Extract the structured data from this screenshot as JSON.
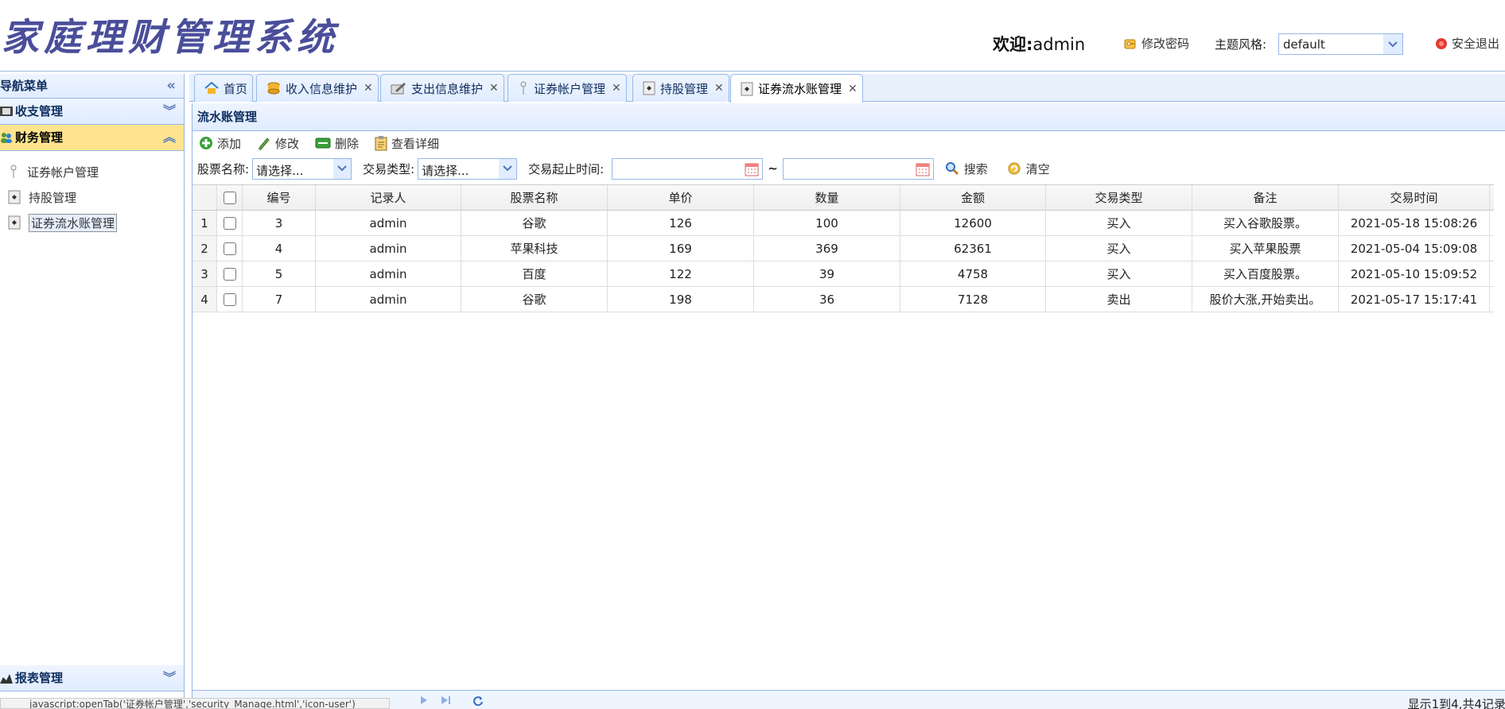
{
  "header": {
    "logo_text": "家庭理财管理系统",
    "welcome_label": "欢迎:",
    "username": "admin",
    "change_password": "修改密码",
    "theme_label": "主题风格:",
    "theme_value": "default",
    "logout": "安全退出"
  },
  "sidebar": {
    "title": "导航菜单",
    "groups": [
      {
        "label": "收支管理"
      },
      {
        "label": "财务管理"
      },
      {
        "label": "报表管理"
      }
    ],
    "items": [
      {
        "label": "证券帐户管理"
      },
      {
        "label": "持股管理"
      },
      {
        "label": "证券流水账管理"
      }
    ]
  },
  "tabs": [
    {
      "label": "首页"
    },
    {
      "label": "收入信息维护"
    },
    {
      "label": "支出信息维护"
    },
    {
      "label": "证券帐户管理"
    },
    {
      "label": "持股管理"
    },
    {
      "label": "证券流水账管理"
    }
  ],
  "panel": {
    "title": "流水账管理",
    "toolbar": {
      "add": "添加",
      "edit": "修改",
      "delete": "删除",
      "detail": "查看详细"
    },
    "search": {
      "stock_label": "股票名称:",
      "stock_value": "请选择...",
      "type_label": "交易类型:",
      "type_value": "请选择...",
      "time_label": "交易起止时间:",
      "tilde": "~",
      "search_btn": "搜索",
      "clear_btn": "清空"
    }
  },
  "grid": {
    "columns": [
      "编号",
      "记录人",
      "股票名称",
      "单价",
      "数量",
      "金额",
      "交易类型",
      "备注",
      "交易时间"
    ],
    "rows": [
      {
        "rn": "1",
        "cells": [
          "3",
          "admin",
          "谷歌",
          "126",
          "100",
          "12600",
          "买入",
          "买入谷歌股票。",
          "2021-05-18 15:08:26"
        ]
      },
      {
        "rn": "2",
        "cells": [
          "4",
          "admin",
          "苹果科技",
          "169",
          "369",
          "62361",
          "买入",
          "买入苹果股票",
          "2021-05-04 15:09:08"
        ]
      },
      {
        "rn": "3",
        "cells": [
          "5",
          "admin",
          "百度",
          "122",
          "39",
          "4758",
          "买入",
          "买入百度股票。",
          "2021-05-10 15:09:52"
        ]
      },
      {
        "rn": "4",
        "cells": [
          "7",
          "admin",
          "谷歌",
          "198",
          "36",
          "7128",
          "卖出",
          "股价大涨,开始卖出。",
          "2021-05-17 15:17:41"
        ]
      }
    ]
  },
  "pager": {
    "info": "显示1到4,共4记录"
  },
  "statusbar": "javascript:openTab('证券帐户管理','security_Manage.html','icon-user')"
}
